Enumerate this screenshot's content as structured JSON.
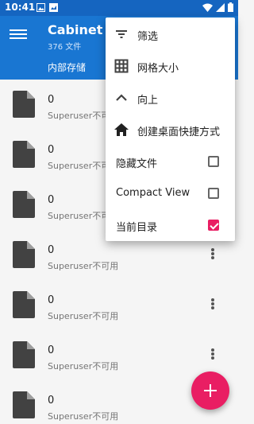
{
  "status_bar": {
    "time": "10:41"
  },
  "app": {
    "title": "Cabinet",
    "subtitle": "376 文件",
    "breadcrumb": "内部存储"
  },
  "files": [
    {
      "name": "0",
      "detail": "Superuser不可用"
    },
    {
      "name": "0",
      "detail": "Superuser不可用"
    },
    {
      "name": "0",
      "detail": "Superuser不可用"
    },
    {
      "name": "0",
      "detail": "Superuser不可用"
    },
    {
      "name": "0",
      "detail": "Superuser不可用"
    },
    {
      "name": "0",
      "detail": "Superuser不可用"
    },
    {
      "name": "0",
      "detail": "Superuser不可用"
    }
  ],
  "menu": {
    "items": [
      {
        "label": "筛选",
        "icon": "filter-icon"
      },
      {
        "label": "网格大小",
        "icon": "grid-icon"
      },
      {
        "label": "向上",
        "icon": "chevron-up-icon"
      },
      {
        "label": "创建桌面快捷方式",
        "icon": "home-icon"
      },
      {
        "label": "隐藏文件",
        "checked": false
      },
      {
        "label": "Compact View",
        "checked": false
      },
      {
        "label": "当前目录",
        "checked": true
      }
    ]
  },
  "colors": {
    "primary": "#1976d2",
    "status_bar": "#1565c0",
    "accent": "#e91e63"
  }
}
